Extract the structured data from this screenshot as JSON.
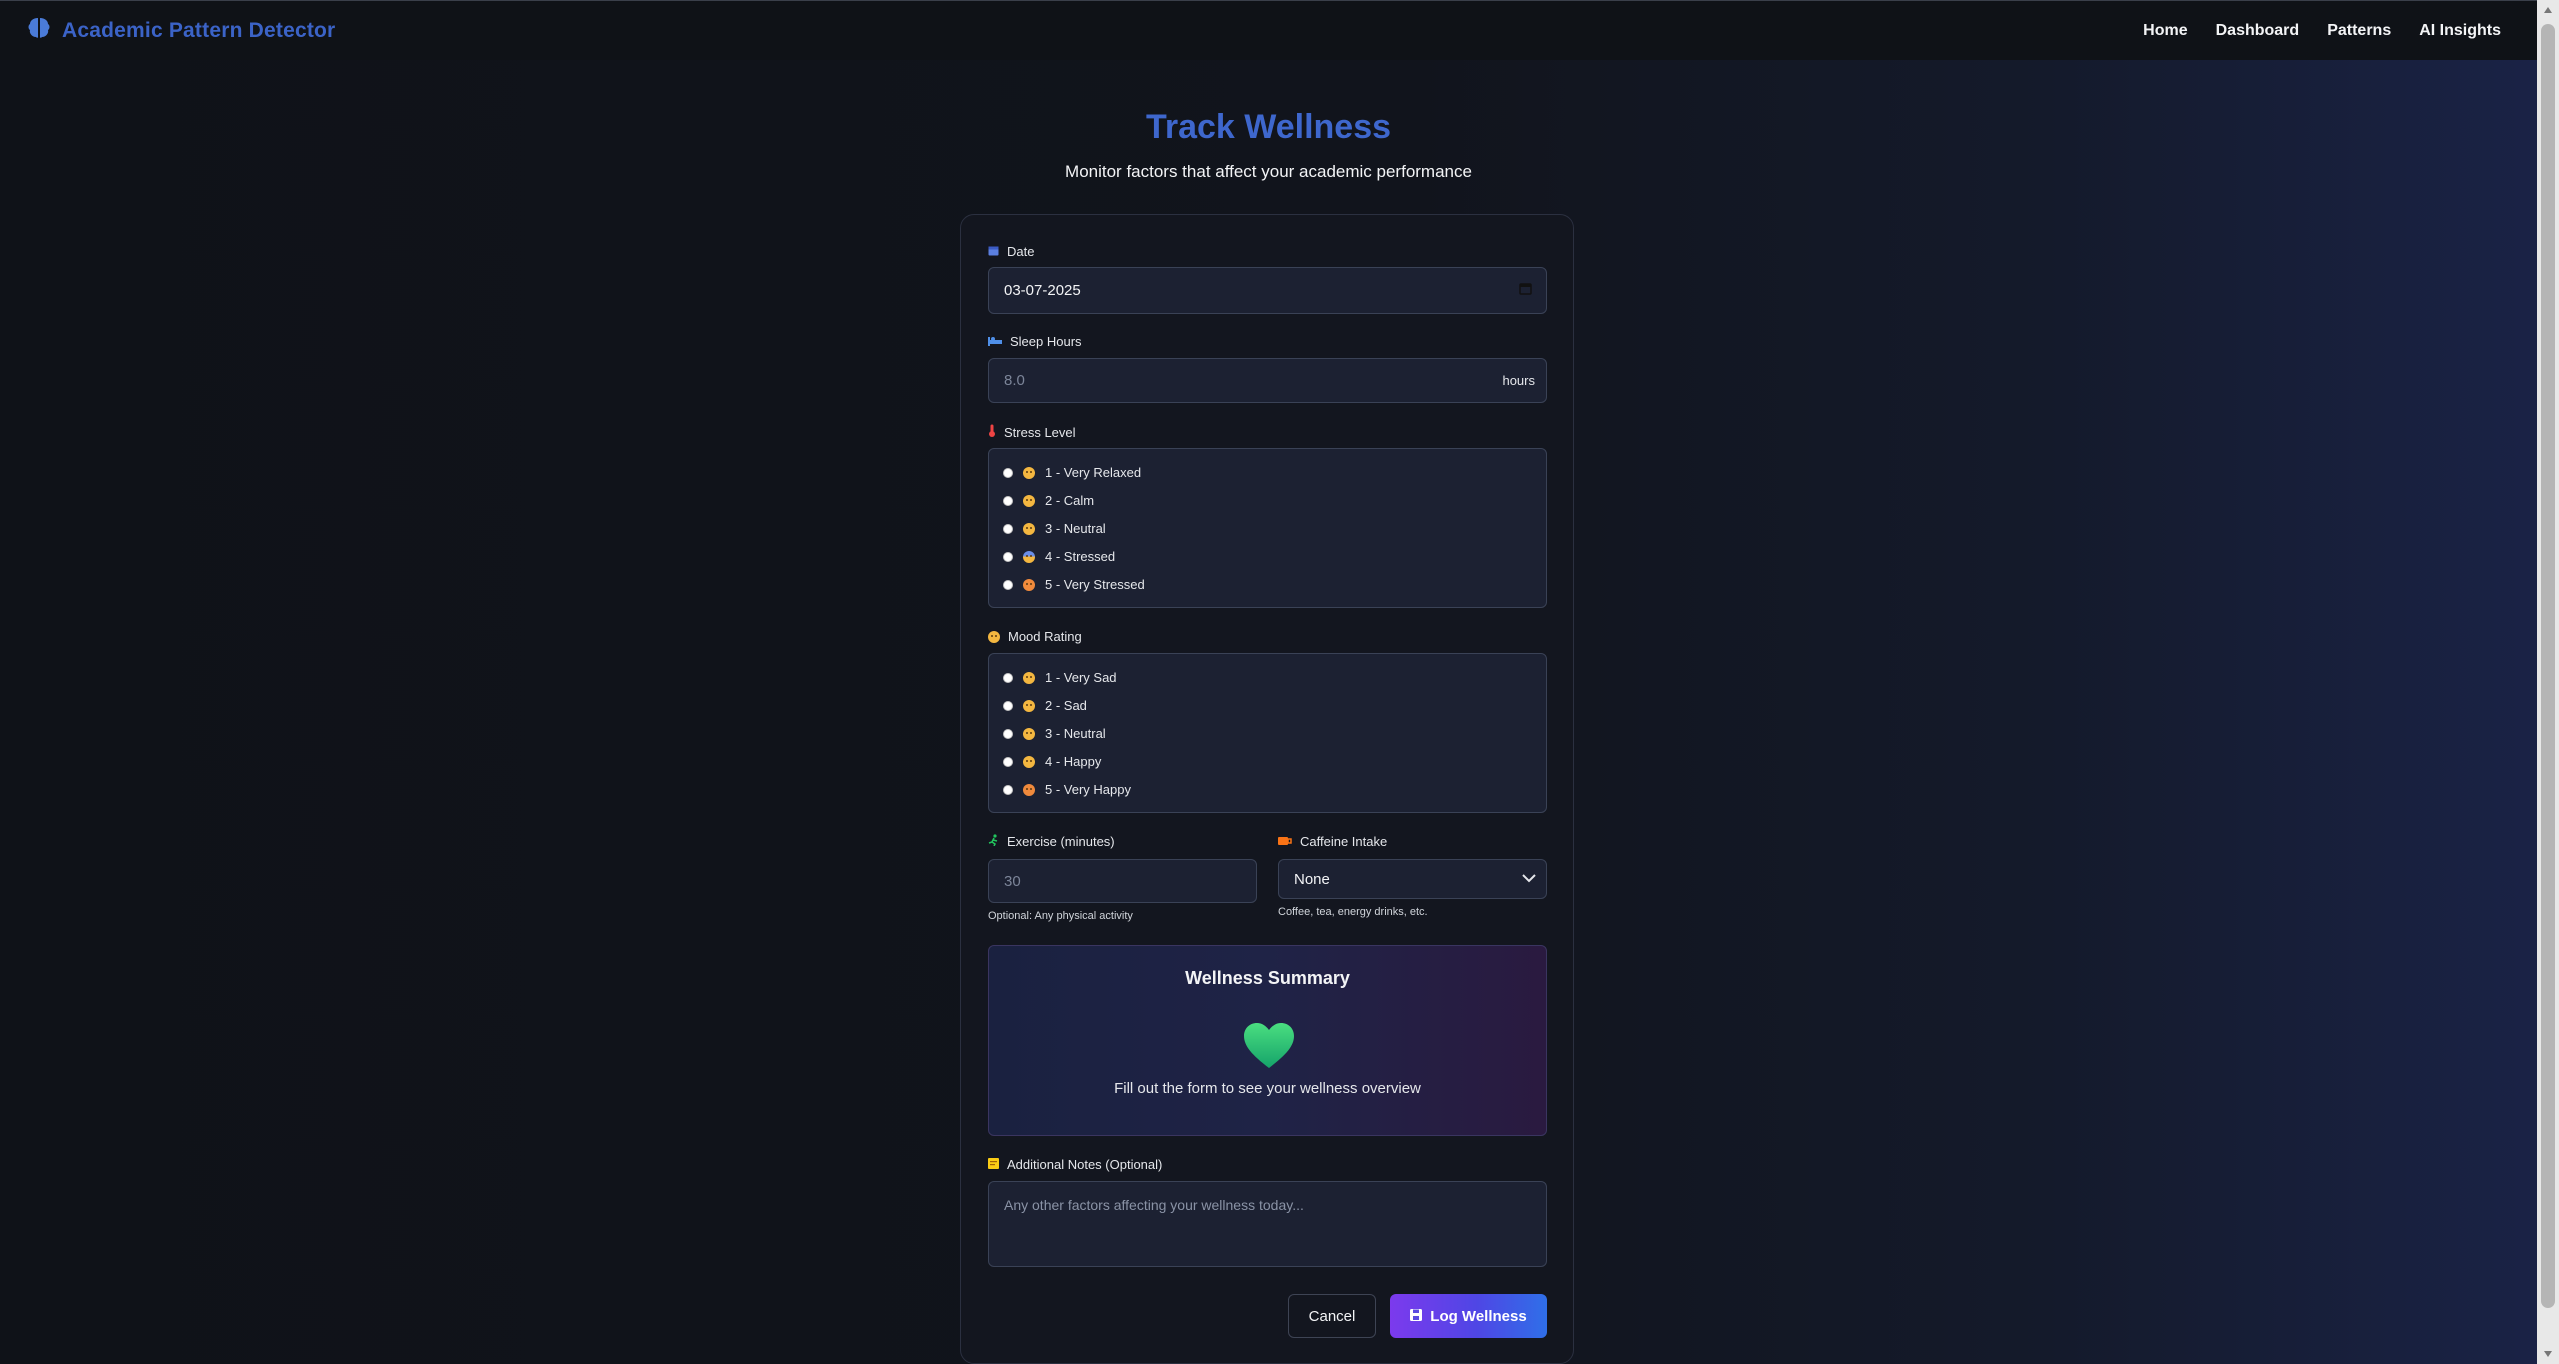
{
  "nav": {
    "brand": "Academic Pattern Detector",
    "links": [
      "Home",
      "Dashboard",
      "Patterns",
      "AI Insights"
    ]
  },
  "header": {
    "title": "Track Wellness",
    "subtitle": "Monitor factors that affect your academic performance"
  },
  "form": {
    "date": {
      "label": "Date",
      "value": "03-07-2025"
    },
    "sleep": {
      "label": "Sleep Hours",
      "placeholder": "8.0",
      "unit": "hours"
    },
    "stress": {
      "label": "Stress Level",
      "options": [
        "1 - Very Relaxed",
        "2 - Calm",
        "3 - Neutral",
        "4 - Stressed",
        "5 - Very Stressed"
      ]
    },
    "mood": {
      "label": "Mood Rating",
      "options": [
        "1 - Very Sad",
        "2 - Sad",
        "3 - Neutral",
        "4 - Happy",
        "5 - Very Happy"
      ]
    },
    "exercise": {
      "label": "Exercise (minutes)",
      "placeholder": "30",
      "help": "Optional: Any physical activity"
    },
    "caffeine": {
      "label": "Caffeine Intake",
      "value": "None",
      "help": "Coffee, tea, energy drinks, etc."
    },
    "summary": {
      "title": "Wellness Summary",
      "text": "Fill out the form to see your wellness overview"
    },
    "notes": {
      "label": "Additional Notes (Optional)",
      "placeholder": "Any other factors affecting your wellness today..."
    },
    "buttons": {
      "cancel": "Cancel",
      "submit": "Log Wellness"
    }
  },
  "colors": {
    "accent": "#3e67cd",
    "card_bg": "#13161f",
    "input_bg": "#1c2132",
    "heart": "#2fbf7a"
  },
  "icons": {
    "brand": "brain-icon",
    "date": "calendar-icon",
    "sleep": "bed-icon",
    "stress": "thermometer-icon",
    "mood": "smiley-icon",
    "exercise": "running-icon",
    "caffeine": "coffee-icon",
    "notes": "sticky-note-icon",
    "submit": "save-icon"
  }
}
